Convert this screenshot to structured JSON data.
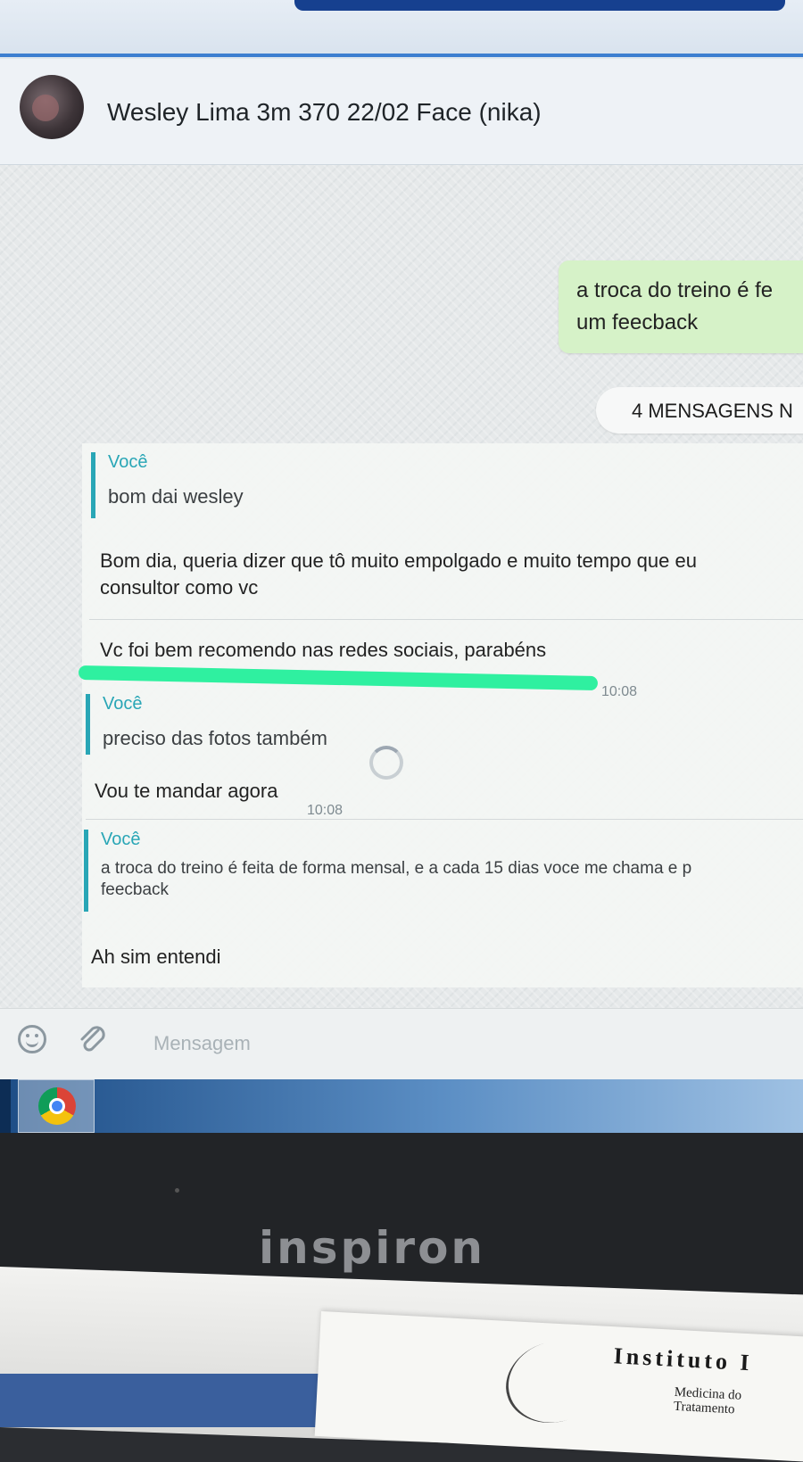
{
  "chat": {
    "contact_name": "Wesley Lima 3m 370 22/02 Face (nika)",
    "outgoing": {
      "line1": "a troca do treino é fe",
      "line2": "um feecback"
    },
    "unread_banner": "4 MENSAGENS N",
    "messages": [
      {
        "quote_author": "Você",
        "quote_text": "bom dai wesley",
        "text_line1": "Bom dia, queria dizer que tô muito empolgado e muito tempo que eu",
        "text_line2": "consultor como vc",
        "text_line3": "Vc foi bem recomendo nas redes sociais, parabéns",
        "time": "10:08"
      },
      {
        "quote_author": "Você",
        "quote_text": "preciso das fotos também",
        "text": "Vou te mandar agora",
        "time": "10:08"
      },
      {
        "quote_author": "Você",
        "quote_text_line1": "a troca do treino é feita de forma mensal, e a cada 15 dias voce me chama e p",
        "quote_text_line2": "feecback",
        "text": "Ah sim entendi"
      }
    ],
    "composer_placeholder": "Mensagem"
  },
  "laptop": {
    "brand": "inspiron"
  },
  "paper": {
    "title": "Instituto I",
    "sub_line1": "Medicina do",
    "sub_line2": "Tratamento"
  },
  "colors": {
    "quote_accent": "#29a6b6",
    "outgoing_bubble": "#d6f2c8",
    "highlight": "#2ff0a0"
  },
  "icons": [
    "emoji-icon",
    "paperclip-icon",
    "chrome-icon"
  ]
}
